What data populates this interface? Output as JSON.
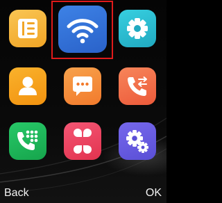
{
  "apps": [
    {
      "name": "notes",
      "icon": "notes-list-icon",
      "color": "#f5b83a",
      "selected": false
    },
    {
      "name": "wifi",
      "icon": "wifi-icon",
      "color": "#2f6fd6",
      "selected": true
    },
    {
      "name": "settings",
      "icon": "gear-icon",
      "color": "#27bcd0",
      "selected": false
    },
    {
      "name": "contacts",
      "icon": "contact-person-icon",
      "color": "#f5a21b",
      "selected": false
    },
    {
      "name": "messages",
      "icon": "message-bubble-icon",
      "color": "#f58a3a",
      "selected": false
    },
    {
      "name": "call-log",
      "icon": "call-log-icon",
      "color": "#f06a45",
      "selected": false
    },
    {
      "name": "dialer",
      "icon": "dialpad-phone-icon",
      "color": "#1fb85a",
      "selected": false
    },
    {
      "name": "apps",
      "icon": "app-grid-icon",
      "color": "#ef3f5f",
      "selected": false
    },
    {
      "name": "advanced-settings",
      "icon": "gears-icon",
      "color": "#6a5fe0",
      "selected": false
    }
  ],
  "softkeys": {
    "left": "Back",
    "right": "OK"
  }
}
